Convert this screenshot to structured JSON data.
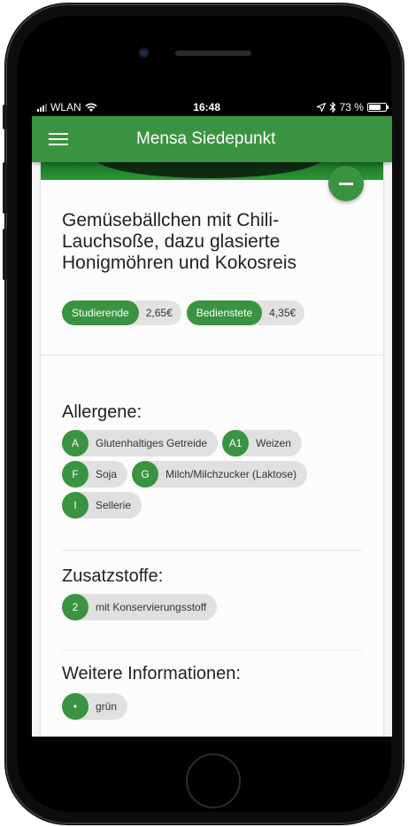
{
  "status_bar": {
    "carrier": "WLAN",
    "time": "16:48",
    "battery_text": "73 %",
    "battery_level": 0.73
  },
  "app_bar": {
    "title": "Mensa Siedepunkt",
    "menu_icon": "hamburger-menu-icon"
  },
  "meal": {
    "title": "Gemüsebällchen mit Chili-Lauchsoße, dazu glasierte Honigmöhren und Kokosreis",
    "prices": [
      {
        "label": "Studierende",
        "value": "2,65€"
      },
      {
        "label": "Bedienstete",
        "value": "4,35€"
      }
    ]
  },
  "sections": {
    "allergens": {
      "title": "Allergene:",
      "items": [
        {
          "code": "A",
          "label": "Glutenhaltiges Getreide"
        },
        {
          "code": "A1",
          "label": "Weizen"
        },
        {
          "code": "F",
          "label": "Soja"
        },
        {
          "code": "G",
          "label": "Milch/Milchzucker (Laktose)"
        },
        {
          "code": "I",
          "label": "Sellerie"
        }
      ]
    },
    "additives": {
      "title": "Zusatzstoffe:",
      "items": [
        {
          "code": "2",
          "label": "mit Konservierungsstoff"
        }
      ]
    },
    "more_info": {
      "title": "Weitere Informationen:",
      "items": [
        {
          "code": "•",
          "label": "grün"
        }
      ]
    }
  },
  "colors": {
    "primary": "#3a9340",
    "chip_background": "#e0e0e0"
  }
}
